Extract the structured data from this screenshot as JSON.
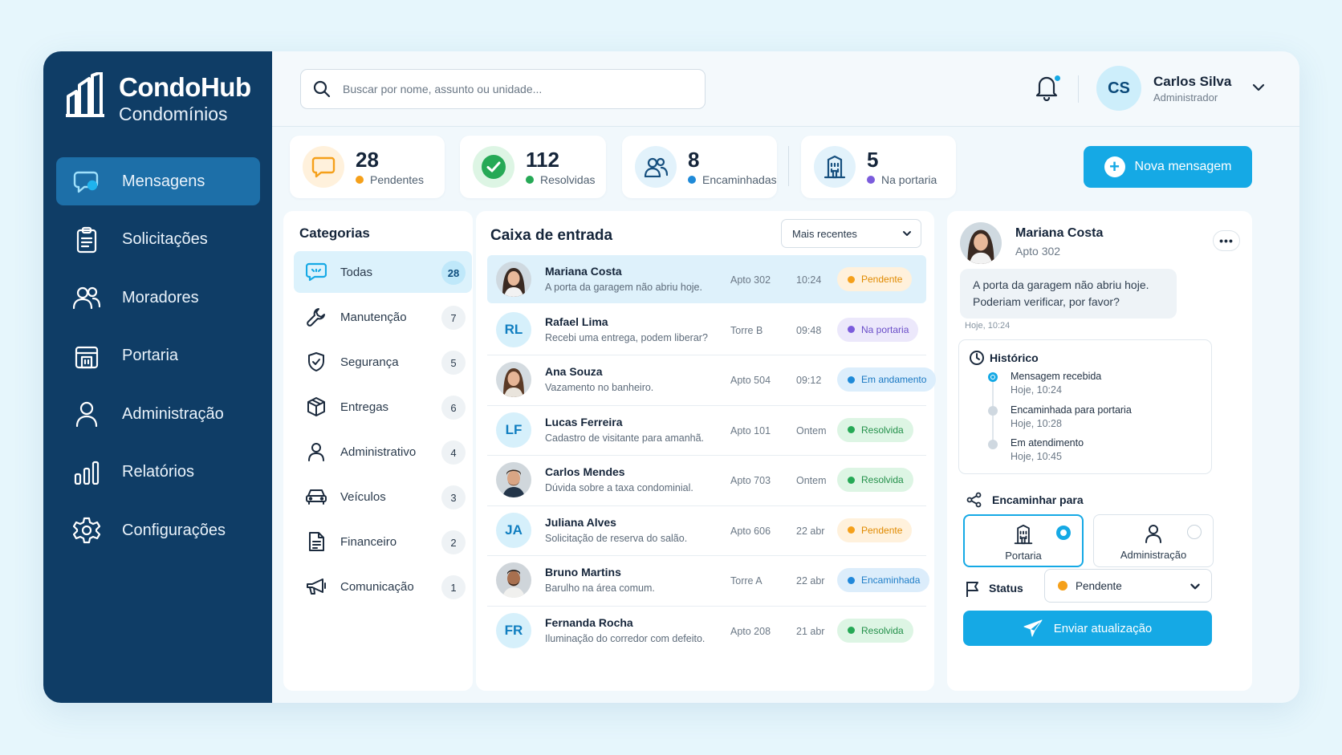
{
  "brand": {
    "name": "CondoHub",
    "subtitle": "Condomínios"
  },
  "nav": [
    {
      "label": "Mensagens",
      "icon": "chat-icon",
      "active": true
    },
    {
      "label": "Solicitações",
      "icon": "clipboard-icon"
    },
    {
      "label": "Moradores",
      "icon": "users-icon"
    },
    {
      "label": "Portaria",
      "icon": "building-icon"
    },
    {
      "label": "Administração",
      "icon": "user-icon"
    },
    {
      "label": "Relatórios",
      "icon": "bar-chart-icon"
    },
    {
      "label": "Configurações",
      "icon": "gear-icon"
    }
  ],
  "search": {
    "placeholder": "Buscar por nome, assunto ou unidade..."
  },
  "user": {
    "initials": "CS",
    "name": "Carlos Silva",
    "role": "Administrador"
  },
  "stats": [
    {
      "value": "28",
      "label": "Pendentes",
      "dot": "#f5a01a"
    },
    {
      "value": "112",
      "label": "Resolvidas",
      "dot": "#26a956"
    },
    {
      "value": "8",
      "label": "Encaminhadas",
      "dot": "#1f8ad8"
    },
    {
      "value": "5",
      "label": "Na portaria",
      "dot": "#7b5cdc"
    }
  ],
  "new_message": {
    "label": "Nova mensagem"
  },
  "categories": {
    "title": "Categorias",
    "items": [
      {
        "label": "Todas",
        "count": "28"
      },
      {
        "label": "Manutenção",
        "count": "7"
      },
      {
        "label": "Segurança",
        "count": "5"
      },
      {
        "label": "Entregas",
        "count": "6"
      },
      {
        "label": "Administrativo",
        "count": "4"
      },
      {
        "label": "Veículos",
        "count": "3"
      },
      {
        "label": "Financeiro",
        "count": "2"
      },
      {
        "label": "Comunicação",
        "count": "1"
      }
    ]
  },
  "inbox": {
    "title": "Caixa de entrada",
    "sort": "Mais recentes",
    "rows": [
      {
        "name": "Mariana Costa",
        "message": "A porta da garagem não abriu hoje.",
        "unit": "Apto 302",
        "time": "10:24",
        "status": "Pendente"
      },
      {
        "initials": "RL",
        "name": "Rafael Lima",
        "message": "Recebi uma entrega, podem liberar?",
        "unit": "Torre B",
        "time": "09:48",
        "status": "Na portaria"
      },
      {
        "name": "Ana Souza",
        "message": "Vazamento no banheiro.",
        "unit": "Apto 504",
        "time": "09:12",
        "status": "Em andamento"
      },
      {
        "initials": "LF",
        "name": "Lucas Ferreira",
        "message": "Cadastro de visitante para amanhã.",
        "unit": "Apto 101",
        "time": "Ontem",
        "status": "Resolvida"
      },
      {
        "name": "Carlos Mendes",
        "message": "Dúvida sobre a taxa condominial.",
        "unit": "Apto 703",
        "time": "Ontem",
        "status": "Resolvida"
      },
      {
        "initials": "JA",
        "name": "Juliana Alves",
        "message": "Solicitação de reserva do salão.",
        "unit": "Apto 606",
        "time": "22 abr",
        "status": "Pendente"
      },
      {
        "name": "Bruno Martins",
        "message": "Barulho na área comum.",
        "unit": "Torre A",
        "time": "22 abr",
        "status": "Encaminhada"
      },
      {
        "initials": "FR",
        "name": "Fernanda Rocha",
        "message": "Iluminação do corredor com defeito.",
        "unit": "Apto 208",
        "time": "21 abr",
        "status": "Resolvida"
      }
    ]
  },
  "detail": {
    "name": "Mariana Costa",
    "unit": "Apto 302",
    "message": "A porta da garagem não abriu hoje. Poderiam verificar, por favor?",
    "message_time": "Hoje, 10:24",
    "history_title": "Histórico",
    "history": [
      {
        "event": "Mensagem recebida",
        "time": "Hoje, 10:24"
      },
      {
        "event": "Encaminhada para portaria",
        "time": "Hoje, 10:28"
      },
      {
        "event": "Em atendimento",
        "time": "Hoje, 10:45"
      }
    ],
    "forward_title": "Encaminhar para",
    "forward_options": [
      {
        "label": "Portaria",
        "selected": true
      },
      {
        "label": "Administração",
        "selected": false
      }
    ],
    "status_label": "Status",
    "status_value": "Pendente",
    "send_label": "Enviar atualização"
  }
}
